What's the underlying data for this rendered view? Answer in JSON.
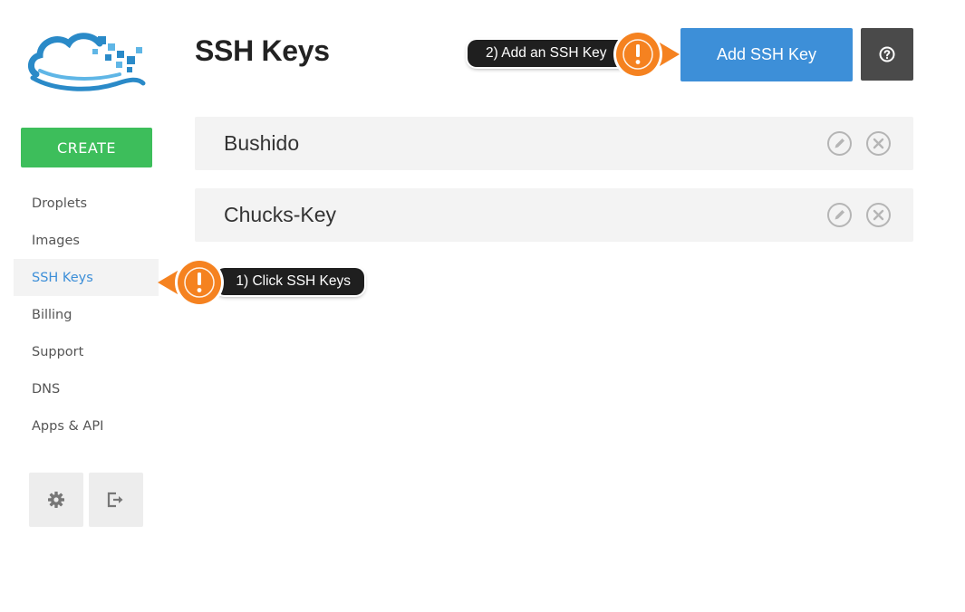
{
  "sidebar": {
    "create_label": "CREATE",
    "items": [
      {
        "label": "Droplets",
        "active": false
      },
      {
        "label": "Images",
        "active": false
      },
      {
        "label": "SSH Keys",
        "active": true
      },
      {
        "label": "Billing",
        "active": false
      },
      {
        "label": "Support",
        "active": false
      },
      {
        "label": "DNS",
        "active": false
      },
      {
        "label": "Apps & API",
        "active": false
      }
    ],
    "tools": [
      {
        "icon": "gear-icon"
      },
      {
        "icon": "logout-icon"
      }
    ]
  },
  "header": {
    "title": "SSH Keys",
    "add_button_label": "Add SSH Key",
    "help_icon": "question-circle-icon"
  },
  "keys": [
    {
      "name": "Bushido"
    },
    {
      "name": "Chucks-Key"
    }
  ],
  "callouts": [
    {
      "text": "1) Click SSH Keys",
      "icon": "exclamation-icon"
    },
    {
      "text": "2) Add an SSH Key",
      "icon": "exclamation-icon"
    }
  ],
  "colors": {
    "create_green": "#3dbe5b",
    "primary_blue": "#3d8fd8",
    "help_dark": "#4a4a4a",
    "callout_orange": "#f58220",
    "callout_dark": "#1f1f1f",
    "row_gray": "#f3f3f3"
  }
}
